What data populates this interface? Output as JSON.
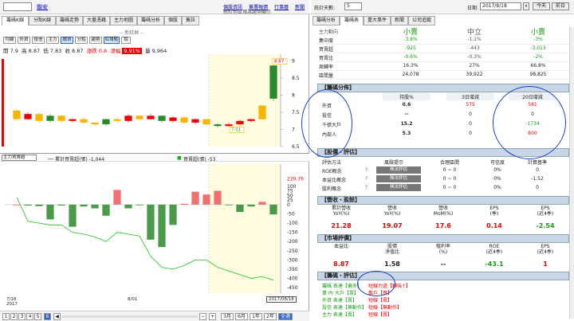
{
  "left": {
    "symbol": "",
    "symbol_name": "聯安",
    "links": [
      "個股資訊",
      "簽署報價",
      "行事曆",
      "新聞"
    ],
    "main_title": "新紅色區塊為趨勢顯示",
    "subtitle": "-- 新紅框 --",
    "tabs": [
      "籌碼K線",
      "分點K線",
      "籌碼走勢",
      "大量憑藉",
      "主力地圖",
      "籌碼分析",
      "個股",
      "簽註"
    ],
    "subtabs": [
      "均線",
      "外資",
      "投信",
      "主力",
      "融資",
      "分點",
      "趨勢",
      "紅綠點",
      "說"
    ],
    "ohlc": {
      "open": "開 7.9",
      "high": "高 8.87",
      "low": "低 7.83",
      "close": "收 8.87",
      "change_label": "漲跌",
      "change": "0.8",
      "pct_label": "漲幅",
      "pct": "9.91%",
      "vol": "量 9,964"
    },
    "indicator_select": "主力買賣超",
    "indicator_legend_1": "── 累計買賣超(張) -1,044",
    "indicator_legend_2": "買賣超(張) -53",
    "date_start": "7/18\n2017",
    "date_mid": "8/01",
    "date_end": "2017/08/18",
    "pages": [
      "1",
      "2",
      "3",
      "4",
      "5",
      "6"
    ],
    "page_selected": "6",
    "period_buttons": [
      "3月",
      "6月",
      "1年",
      "2年",
      "全選"
    ]
  },
  "chart_data": [
    {
      "type": "bar",
      "title": "",
      "xlabel": "",
      "ylabel": "",
      "ylim": [
        6.5,
        9.2
      ],
      "ticks": [
        "9",
        "8.5",
        "8",
        "7.5",
        "7",
        "6.5"
      ],
      "candles": [
        {
          "o": 7.55,
          "c": 7.3,
          "h": 7.6,
          "l": 7.25
        },
        {
          "o": 7.3,
          "c": 7.45,
          "h": 7.5,
          "l": 7.28
        },
        {
          "o": 7.45,
          "c": 7.25,
          "h": 7.5,
          "l": 7.2
        },
        {
          "o": 7.25,
          "c": 7.4,
          "h": 7.45,
          "l": 7.2
        },
        {
          "o": 7.4,
          "c": 7.25,
          "h": 7.42,
          "l": 7.2
        },
        {
          "o": 7.25,
          "c": 7.3,
          "h": 7.32,
          "l": 7.22
        },
        {
          "o": 7.3,
          "c": 7.2,
          "h": 7.35,
          "l": 7.15
        },
        {
          "o": 7.2,
          "c": 7.15,
          "h": 7.22,
          "l": 7.1
        },
        {
          "o": 7.15,
          "c": 7.3,
          "h": 7.32,
          "l": 7.1
        },
        {
          "o": 7.3,
          "c": 7.25,
          "h": 7.35,
          "l": 7.2
        },
        {
          "o": 7.25,
          "c": 7.4,
          "h": 7.45,
          "l": 7.22
        },
        {
          "o": 7.4,
          "c": 7.3,
          "h": 7.42,
          "l": 7.25
        },
        {
          "o": 7.3,
          "c": 7.4,
          "h": 7.45,
          "l": 7.28
        },
        {
          "o": 7.4,
          "c": 7.25,
          "h": 7.42,
          "l": 7.2
        },
        {
          "o": 7.25,
          "c": 7.35,
          "h": 7.38,
          "l": 7.2
        },
        {
          "o": 7.35,
          "c": 7.2,
          "h": 7.38,
          "l": 7.15
        },
        {
          "o": 7.2,
          "c": 7.3,
          "h": 7.32,
          "l": 7.15
        },
        {
          "o": 7.3,
          "c": 7.15,
          "h": 7.32,
          "l": 7.1
        },
        {
          "o": 7.15,
          "c": 7.1,
          "h": 7.18,
          "l": 7.05
        },
        {
          "o": 7.1,
          "c": 7.15,
          "h": 7.2,
          "l": 7.08
        },
        {
          "o": 7.15,
          "c": 7.25,
          "h": 7.28,
          "l": 7.12
        },
        {
          "o": 7.25,
          "c": 7.3,
          "h": 7.3,
          "l": 7.22
        },
        {
          "o": 7.3,
          "c": 7.7,
          "h": 7.7,
          "l": 7.28
        },
        {
          "o": 7.9,
          "c": 8.87,
          "h": 8.87,
          "l": 7.83
        }
      ],
      "low_label": "7.01",
      "high_label": "8.87"
    },
    {
      "type": "bar",
      "title": "",
      "xlabel": "",
      "ylabel": "",
      "ylim": [
        -480,
        220
      ],
      "ticks": [
        "220.76",
        "100",
        "75",
        "50",
        "25",
        "0",
        "-50",
        "-100",
        "-150",
        "-200",
        "-250",
        "-300",
        "-350",
        "-400",
        "-450"
      ],
      "values": [
        0,
        -5,
        -8,
        -80,
        -5,
        -120,
        -10,
        -20,
        -60,
        80,
        -20,
        -2,
        -190,
        -230,
        -110,
        5,
        70,
        55,
        75,
        -3,
        -40,
        -10,
        15,
        -53
      ],
      "cumulative": [
        40,
        -90,
        -100,
        -110,
        -110,
        -150,
        -160,
        -175,
        -200,
        -150,
        -160,
        -170,
        -280,
        -340,
        -350,
        -330,
        -300,
        -300,
        -340,
        -360,
        -380,
        -400,
        -390,
        -410
      ]
    }
  ],
  "right": {
    "days_label": "統計天數:",
    "days_value": "5",
    "date_label": "日期:",
    "date_value": "2017/8/18",
    "today_btn": "今天",
    "prev_btn": "前日",
    "tabs": [
      "籌碼分析",
      "籌碼表",
      "重大事件",
      "新聞",
      "公司追蹤"
    ],
    "summary": {
      "headers": [
        "主力動向",
        "小賣",
        "中立",
        "小賣"
      ],
      "rows": [
        [
          "集中度",
          "-3.8%",
          "-1.1%",
          "-3%"
        ],
        [
          "買賣超",
          "-925",
          "-443",
          "-3,013"
        ],
        [
          "買賣比",
          "-0.6%",
          "-0.3%",
          "-2%"
        ],
        [
          "周轉率",
          "16.3%",
          "27%",
          "66.8%"
        ],
        [
          "區間量",
          "24,078",
          "39,922",
          "98,825"
        ]
      ]
    },
    "chip_dist": {
      "title": "【籌碼分佈】",
      "headers": [
        "",
        "持股%",
        "3日增減",
        "20日增減"
      ],
      "rows": [
        [
          "外資",
          "0.6",
          "575",
          "581"
        ],
        [
          "投信",
          "--",
          "0",
          "0"
        ],
        [
          "千張大戶",
          "15.2",
          "0",
          "-1734"
        ],
        [
          "內部人",
          "5.3",
          "0",
          "800"
        ]
      ]
    },
    "valuation": {
      "title": "【股價・評估】",
      "headers": [
        "評估方法",
        "風險提示",
        "合理區間",
        "可信度",
        "計算基準"
      ],
      "rows": [
        [
          "ROE概念",
          "無法評估",
          "0 ~ 0",
          "0%",
          "0"
        ],
        [
          "本益比概念",
          "無法評估",
          "0 ~ 0",
          "0%",
          "-1.52"
        ],
        [
          "股利概念",
          "無法評估",
          "0 ~ 0",
          "0%",
          "0"
        ]
      ]
    },
    "revenue": {
      "title": "【營收・盈餘】",
      "headers": [
        "累計營收\nYoY(%)",
        "營收\nYoY(%)",
        "營收\nMoM(%)",
        "EPS\n(季)",
        "EPS\n(近4季)"
      ],
      "values": [
        "21.28",
        "19.07",
        "17.6",
        "0.14",
        "-2.54"
      ]
    },
    "market": {
      "title": "【市場評價】",
      "headers": [
        "本益比",
        "股價\n淨值比",
        "殖利率\n(%)",
        "ROE\n(近4季)",
        "EPS\n(近4季)"
      ],
      "values": [
        "8.87",
        "1.58",
        "--",
        "-43.1",
        "1"
      ]
    },
    "chip_eval": {
      "title": "【籌碼・評估】",
      "lines": [
        {
          "a": "籌碼 表達【偏多】",
          "b": "短線力道【轉強↑】"
        },
        {
          "a": "業 內 大戶【賣】",
          "b": "散戶【買】"
        },
        {
          "a": "外資 表達【賣】",
          "b": "短線【賣】"
        },
        {
          "a": "投信 表達【無動作】",
          "b": "短線【無動作】"
        },
        {
          "a": "主力 表達【賣】",
          "b": "短線【賣】"
        }
      ]
    }
  }
}
